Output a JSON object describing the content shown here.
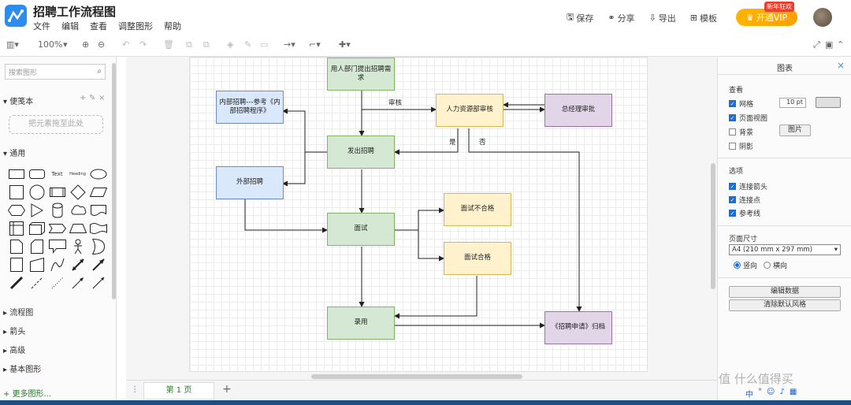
{
  "app": {
    "title": "招聘工作流程图",
    "menu": [
      "文件",
      "编辑",
      "查看",
      "调整图形",
      "帮助"
    ]
  },
  "header_actions": {
    "save": "保存",
    "share": "分享",
    "export": "导出",
    "templates": "模板",
    "vip_label": "开通VIP",
    "vip_badge": "新年狂欢"
  },
  "toolbar": {
    "zoom": "100%"
  },
  "left_panel": {
    "search_placeholder": "搜索图形",
    "scratchpad": "便笺本",
    "drop_hint": "把元素拖至此处",
    "general": "通用",
    "shape_text_label": "Text",
    "shape_heading_label": "Heading",
    "categories": [
      "流程图",
      "箭头",
      "高级",
      "基本图形"
    ],
    "more_shapes": "更多图形..."
  },
  "diagram": {
    "nodes": {
      "dept_request": "用人部门提出招聘需求",
      "hr_review": "人力资源部审核",
      "gm_approve": "总经理审批",
      "internal": "内部招聘---参考《内部招聘程序》",
      "publish": "发出招聘",
      "external": "外部招聘",
      "interview": "面试",
      "fail": "面试不合格",
      "pass": "面试合格",
      "hire": "录用",
      "archive": "《招聘申请》归档"
    },
    "edge_labels": {
      "review": "审核",
      "yes": "是",
      "no": "否"
    }
  },
  "right_panel": {
    "title": "图表",
    "view_section": "查看",
    "grid": "网格",
    "grid_size": "10 pt",
    "page_view": "页面视图",
    "background": "背景",
    "image_button": "图片",
    "shadow": "阴影",
    "options_section": "选项",
    "connection_arrows": "连接箭头",
    "connection_points": "连接点",
    "guides": "参考线",
    "page_size_section": "页面尺寸",
    "page_size_value": "A4 (210 mm x 297 mm)",
    "portrait": "竖向",
    "landscape": "横向",
    "edit_data": "编辑数据",
    "clear_style": "清除默认风格"
  },
  "bottom": {
    "page_tab": "第 1 页"
  },
  "watermark": "值 什么值得买"
}
